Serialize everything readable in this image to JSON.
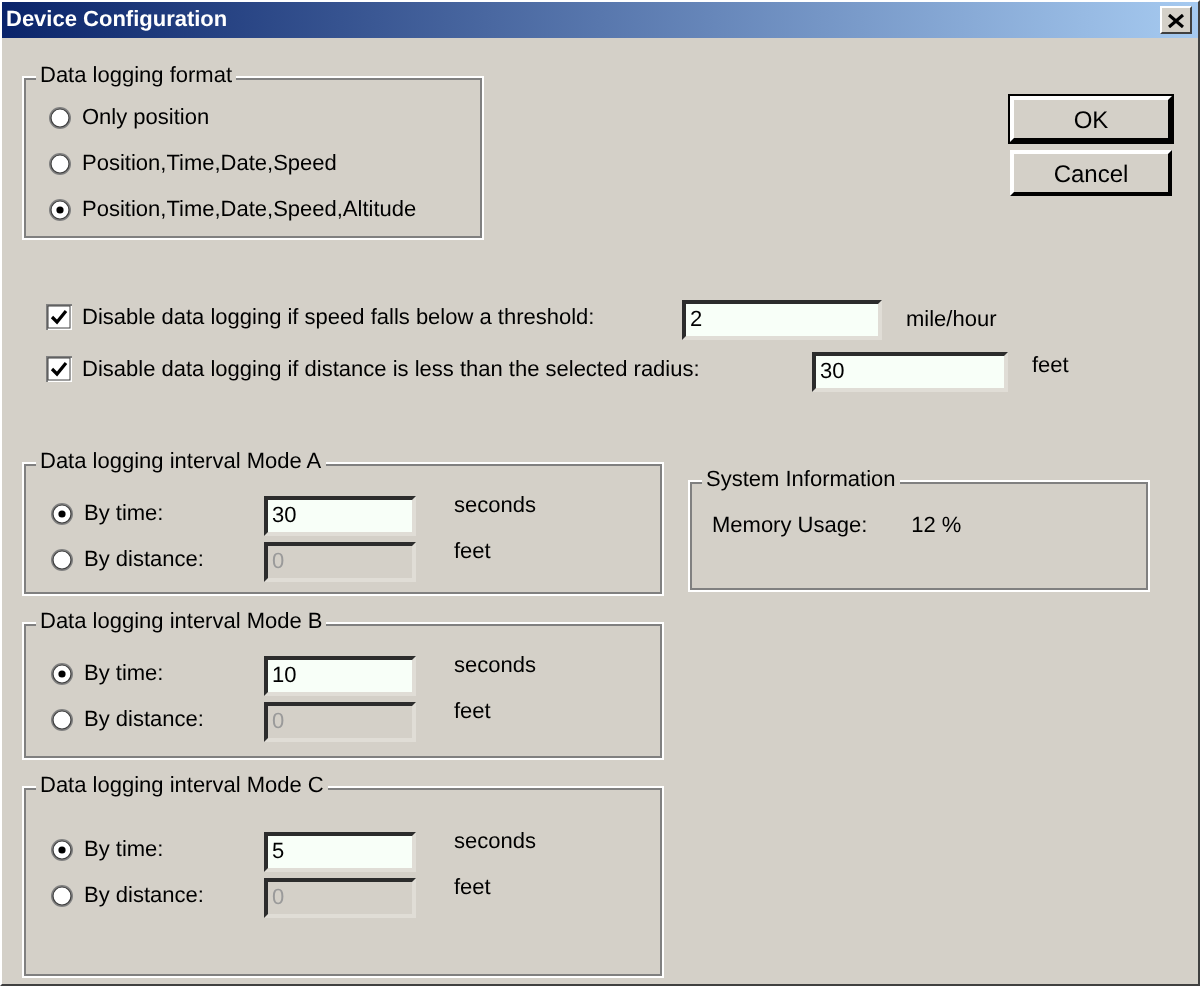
{
  "window": {
    "title": "Device Configuration"
  },
  "format": {
    "title": "Data logging format",
    "options": [
      {
        "label": "Only position",
        "selected": false
      },
      {
        "label": "Position,Time,Date,Speed",
        "selected": false
      },
      {
        "label": "Position,Time,Date,Speed,Altitude",
        "selected": true
      }
    ]
  },
  "buttons": [
    "OK",
    "Cancel"
  ],
  "thresholds": [
    {
      "label": "Disable data logging if speed falls below a threshold:",
      "checked": true,
      "value": "2",
      "unit": "mile/hour"
    },
    {
      "label": "Disable data logging if distance is less than the selected radius:",
      "checked": true,
      "value": "30",
      "unit": "feet"
    }
  ],
  "modes": [
    {
      "title": "Data logging interval Mode A",
      "options": [
        {
          "label": "By time:",
          "selected": true,
          "value": "30",
          "unit": "seconds",
          "disabled": false
        },
        {
          "label": "By distance:",
          "selected": false,
          "value": "0",
          "unit": "feet",
          "disabled": true
        }
      ]
    },
    {
      "title": "Data logging interval Mode B",
      "options": [
        {
          "label": "By time:",
          "selected": true,
          "value": "10",
          "unit": "seconds",
          "disabled": false
        },
        {
          "label": "By distance:",
          "selected": false,
          "value": "0",
          "unit": "feet",
          "disabled": true
        }
      ]
    },
    {
      "title": "Data logging interval Mode C",
      "options": [
        {
          "label": "By time:",
          "selected": true,
          "value": "5",
          "unit": "seconds",
          "disabled": false
        },
        {
          "label": "By distance:",
          "selected": false,
          "value": "0",
          "unit": "feet",
          "disabled": true
        }
      ]
    }
  ],
  "system_info": {
    "title": "System Information",
    "label": "Memory Usage:",
    "value": "12 %"
  }
}
